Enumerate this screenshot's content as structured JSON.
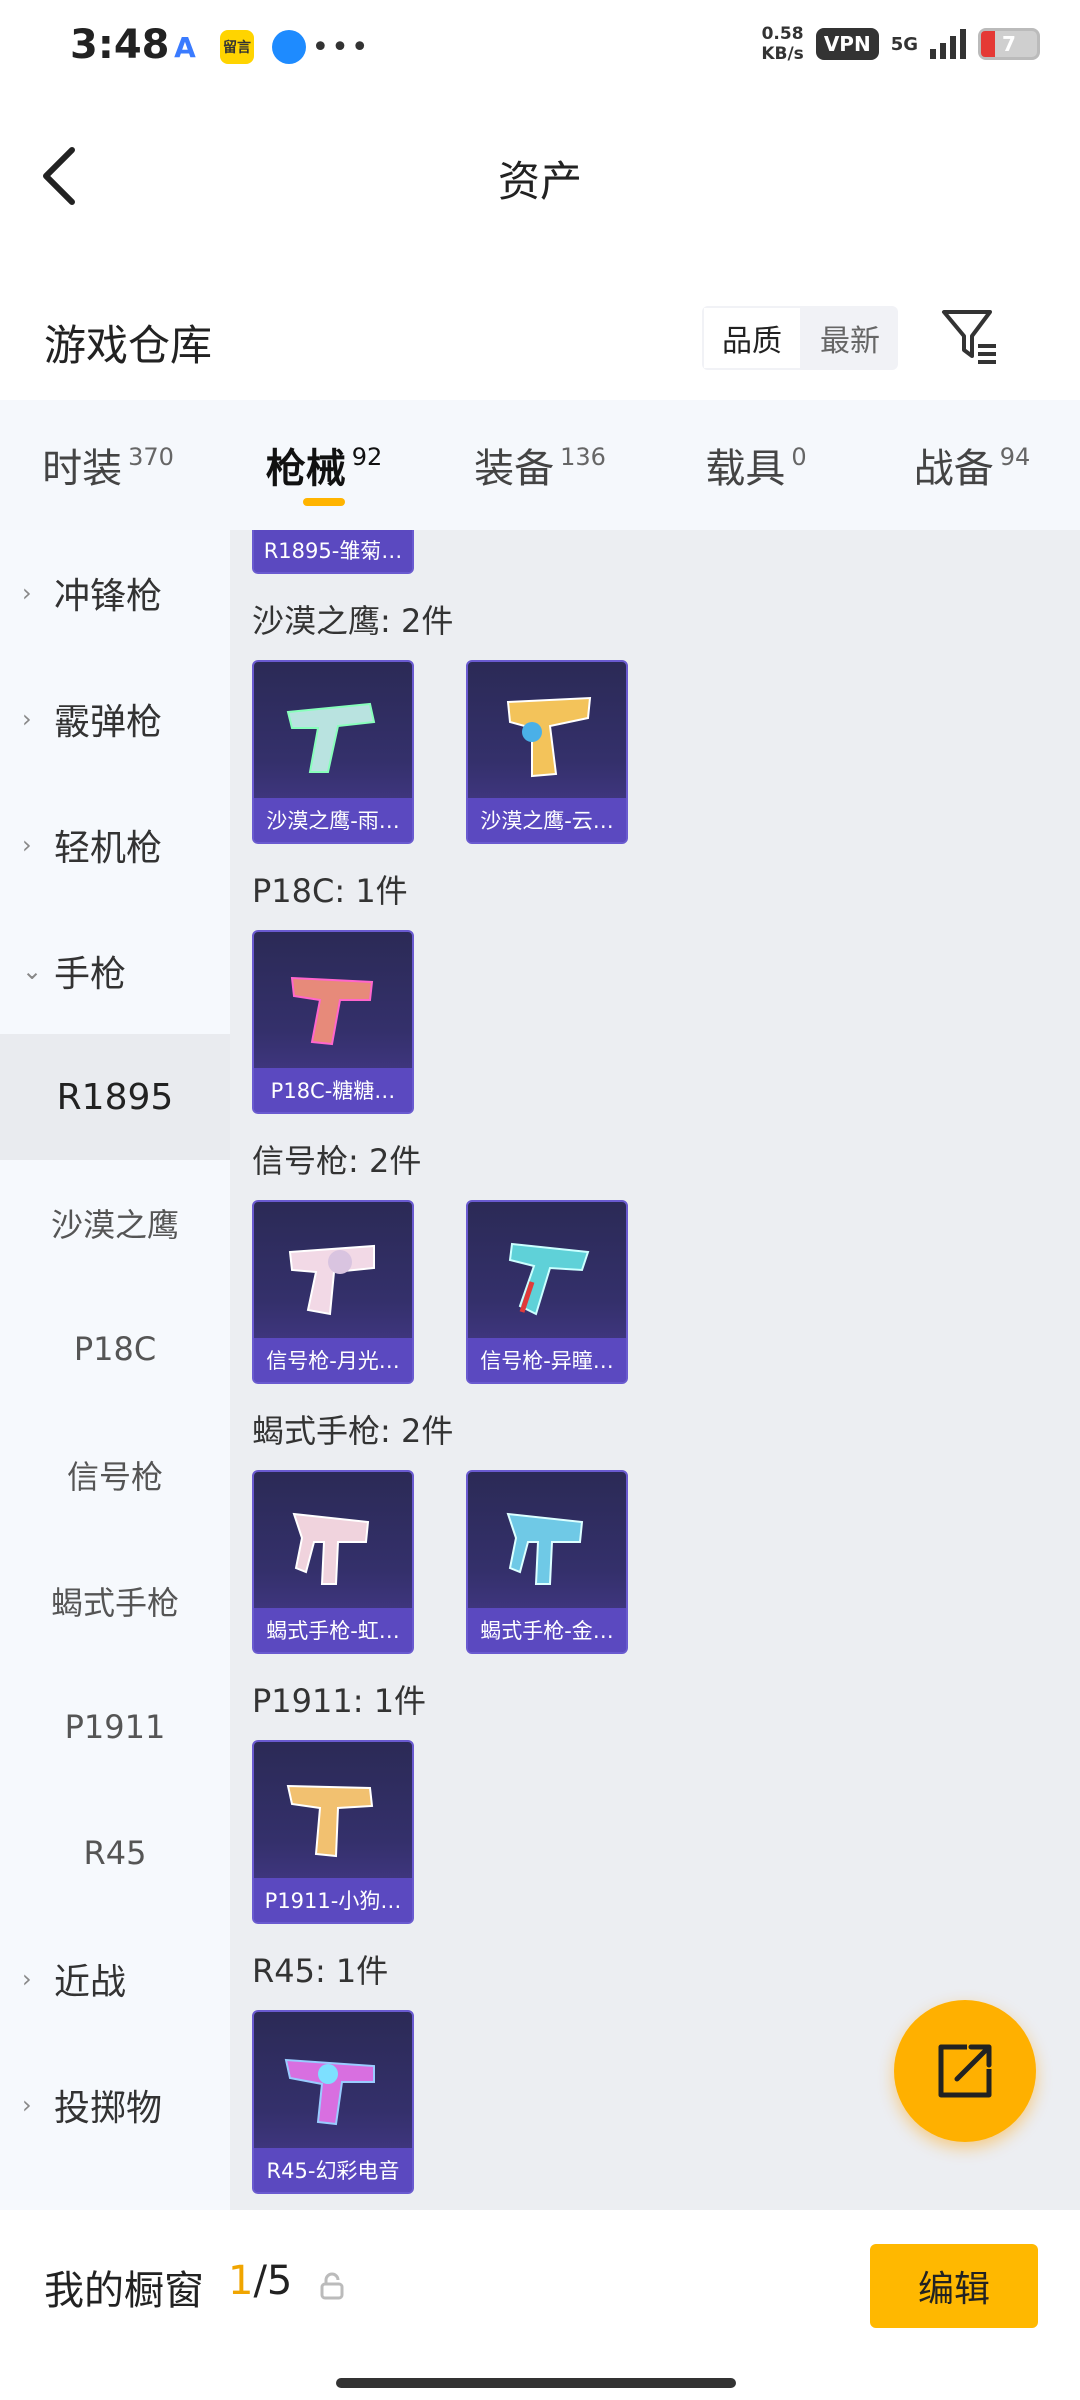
{
  "status_bar": {
    "time": "3:48",
    "speed_value": "0.58",
    "speed_unit": "KB/s",
    "vpn": "VPN",
    "network": "5G",
    "battery": "7",
    "app_icon_b": "留言"
  },
  "header": {
    "title": "资产"
  },
  "warehouse": {
    "title": "游戏仓库",
    "sort_options": [
      "品质",
      "最新"
    ],
    "active_sort": "品质"
  },
  "tabs": [
    {
      "label": "时装",
      "count": "370"
    },
    {
      "label": "枪械",
      "count": "92",
      "active": true
    },
    {
      "label": "装备",
      "count": "136"
    },
    {
      "label": "载具",
      "count": "0"
    },
    {
      "label": "战备",
      "count": "94"
    }
  ],
  "sidebar": {
    "items": [
      {
        "type": "category",
        "label": "冲锋枪",
        "expanded": false
      },
      {
        "type": "category",
        "label": "霰弹枪",
        "expanded": false
      },
      {
        "type": "category",
        "label": "轻机枪",
        "expanded": false
      },
      {
        "type": "category",
        "label": "手枪",
        "expanded": true
      },
      {
        "type": "sub",
        "label": "R1895",
        "active": true
      },
      {
        "type": "sub",
        "label": "沙漠之鹰"
      },
      {
        "type": "sub",
        "label": "P18C"
      },
      {
        "type": "sub",
        "label": "信号枪"
      },
      {
        "type": "sub",
        "label": "蝎式手枪"
      },
      {
        "type": "sub",
        "label": "P1911"
      },
      {
        "type": "sub",
        "label": "R45"
      },
      {
        "type": "category",
        "label": "近战",
        "expanded": false
      },
      {
        "type": "category",
        "label": "投掷物",
        "expanded": false
      }
    ]
  },
  "content": {
    "partial_card_label": "R1895-雏菊…",
    "groups": [
      {
        "title": "沙漠之鹰: 2件",
        "items": [
          {
            "label": "沙漠之鹰-雨…",
            "color": "#b9e3e0"
          },
          {
            "label": "沙漠之鹰-云…",
            "color": "#f3c35a"
          }
        ]
      },
      {
        "title": "P18C: 1件",
        "items": [
          {
            "label": "P18C-糖糖…",
            "color": "#e78a7a"
          }
        ]
      },
      {
        "title": "信号枪: 2件",
        "items": [
          {
            "label": "信号枪-月光…",
            "color": "#f2d9e6"
          },
          {
            "label": "信号枪-异瞳…",
            "color": "#5fd1d8"
          }
        ]
      },
      {
        "title": "蝎式手枪: 2件",
        "items": [
          {
            "label": "蝎式手枪-虹…",
            "color": "#f0d3dd"
          },
          {
            "label": "蝎式手枪-金…",
            "color": "#6fc9e6"
          }
        ]
      },
      {
        "title": "P1911: 1件",
        "items": [
          {
            "label": "P1911-小狗…",
            "color": "#f2c170"
          }
        ]
      },
      {
        "title": "R45: 1件",
        "items": [
          {
            "label": "R45-幻彩电音",
            "color": "#d86fe0"
          }
        ]
      }
    ]
  },
  "bottom_bar": {
    "showcase_label": "我的橱窗",
    "showcase_current": "1",
    "showcase_total": "/5",
    "edit_label": "编辑"
  },
  "colors": {
    "accent": "#ffb800",
    "card_bg": "#34306b",
    "card_label_bg": "#5b49c0"
  }
}
